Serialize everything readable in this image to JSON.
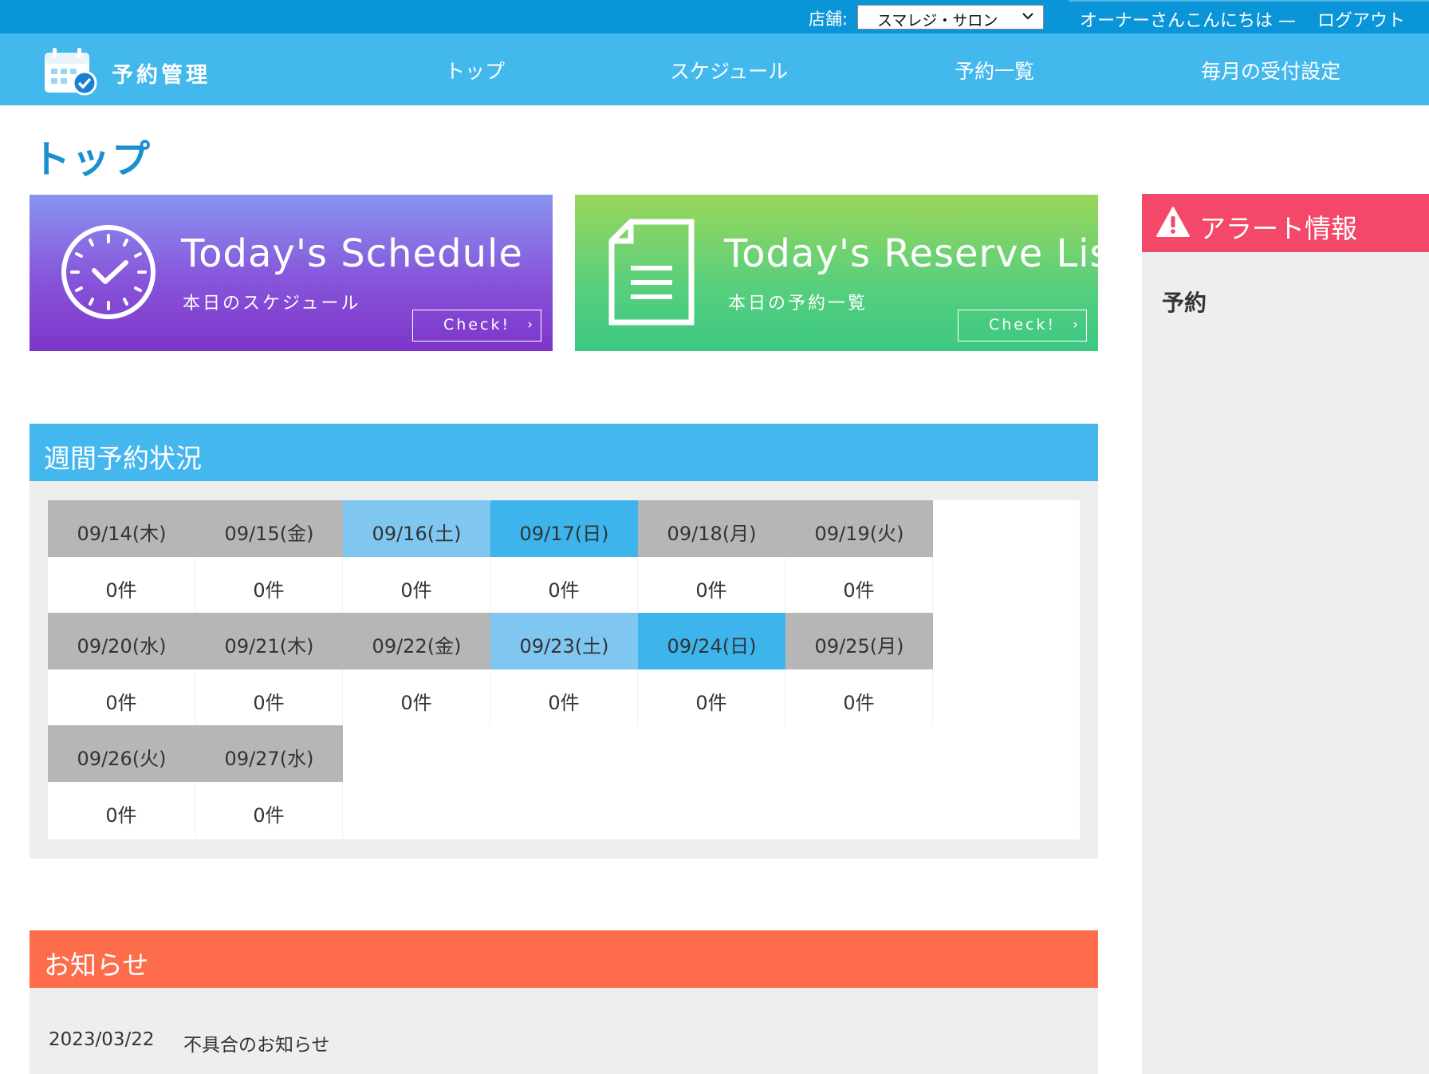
{
  "topbar": {
    "store_label": "店舗:",
    "store_selected": "スマレジ・サロン",
    "greeting": "オーナーさんこんにちは —",
    "logout": "ログアウト"
  },
  "nav": {
    "logo_text": "予約管理",
    "items": [
      "トップ",
      "スケジュール",
      "予約一覧",
      "毎月の受付設定"
    ]
  },
  "page_title": "トップ",
  "banners": {
    "schedule": {
      "title": "Today's Schedule",
      "subtitle": "本日のスケジュール",
      "check": "Check!",
      "arrow": "›"
    },
    "reserve": {
      "title": "Today's Reserve List",
      "subtitle": "本日の予約一覧",
      "check": "Check!",
      "arrow": "›"
    }
  },
  "weekly": {
    "title": "週間予約状況",
    "days": [
      {
        "label": "09/14(木)",
        "count": "0件",
        "type": "weekday"
      },
      {
        "label": "09/15(金)",
        "count": "0件",
        "type": "weekday"
      },
      {
        "label": "09/16(土)",
        "count": "0件",
        "type": "sat"
      },
      {
        "label": "09/17(日)",
        "count": "0件",
        "type": "sun"
      },
      {
        "label": "09/18(月)",
        "count": "0件",
        "type": "weekday"
      },
      {
        "label": "09/19(火)",
        "count": "0件",
        "type": "weekday"
      },
      {
        "label": "09/20(水)",
        "count": "0件",
        "type": "weekday"
      },
      {
        "label": "09/21(木)",
        "count": "0件",
        "type": "weekday"
      },
      {
        "label": "09/22(金)",
        "count": "0件",
        "type": "weekday"
      },
      {
        "label": "09/23(土)",
        "count": "0件",
        "type": "sat"
      },
      {
        "label": "09/24(日)",
        "count": "0件",
        "type": "sun"
      },
      {
        "label": "09/25(月)",
        "count": "0件",
        "type": "weekday"
      },
      {
        "label": "09/26(火)",
        "count": "0件",
        "type": "weekday"
      },
      {
        "label": "09/27(水)",
        "count": "0件",
        "type": "weekday"
      }
    ]
  },
  "notice": {
    "title": "お知らせ",
    "items": [
      {
        "date": "2023/03/22",
        "text": "不具合のお知らせ"
      }
    ]
  },
  "alert": {
    "title": "アラート情報",
    "items": [
      "予約"
    ]
  },
  "colors": {
    "topbar": "#0a95d8",
    "navbar": "#43b8ed",
    "saturday": "#7fc6f0",
    "sunday": "#3db4ec",
    "weekday": "#b6b6b6",
    "notice": "#fd6d4c",
    "alert": "#f4486a"
  }
}
